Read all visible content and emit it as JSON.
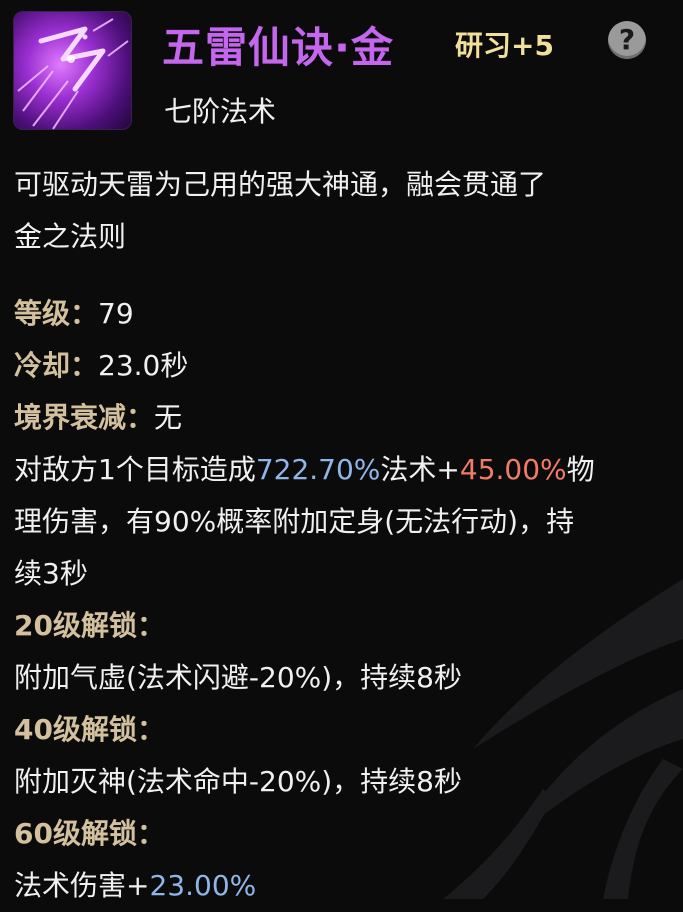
{
  "skill": {
    "name": "五雷仙诀·金",
    "research": "研习+5",
    "grade": "七阶法术",
    "icon": "purple-lightning-icon",
    "help": "?"
  },
  "description": [
    "可驱动天雷为己用的强大神通，融会贯通了",
    "金之法则"
  ],
  "stats": {
    "level_label": "等级：",
    "level_value": "79",
    "cooldown_label": "冷却：",
    "cooldown_value": "23.0秒",
    "decay_label": "境界衰减：",
    "decay_value": "无"
  },
  "effect": {
    "part1": "对敌方1个目标造成",
    "magic_pct": "722.70%",
    "part2": "法术+",
    "physical_pct": "45.00%",
    "part3": "物",
    "line2": "理伤害，有90%概率附加定身(无法行动)，持",
    "line3": "续3秒"
  },
  "unlocks": [
    {
      "heading": "20级解锁：",
      "text": "附加气虚(法术闪避-20%)，持续8秒"
    },
    {
      "heading": "40级解锁：",
      "text": "附加灭神(法术命中-20%)，持续8秒"
    },
    {
      "heading": "60级解锁：",
      "text_prefix": "法术伤害+",
      "value": "23.00%"
    }
  ],
  "colors": {
    "name": "#c466ee",
    "research": "#f2df9a",
    "label": "#d3c19e",
    "blue_value": "#8fb6e8",
    "red_value": "#f07c66"
  }
}
